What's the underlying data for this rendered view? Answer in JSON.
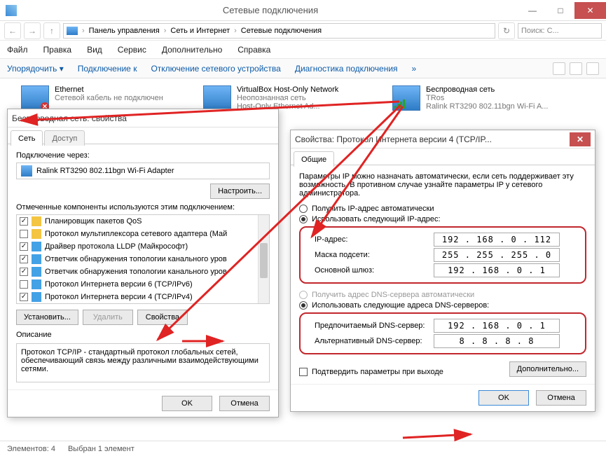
{
  "window": {
    "title": "Сетевые подключения",
    "minimize": "—",
    "maximize": "□",
    "close": "✕"
  },
  "nav": {
    "back": "←",
    "fwd": "→",
    "up": "↑",
    "crumbs": [
      "Панель управления",
      "Сеть и Интернет",
      "Сетевые подключения"
    ],
    "sep": "›",
    "refresh": "↻",
    "search_placeholder": "Поиск: С..."
  },
  "menu": [
    "Файл",
    "Правка",
    "Вид",
    "Сервис",
    "Дополнительно",
    "Справка"
  ],
  "commands": {
    "organize": "Упорядочить ▾",
    "connect": "Подключение к",
    "disable": "Отключение сетевого устройства",
    "diag": "Диагностика подключения",
    "more": "»"
  },
  "items": {
    "eth": {
      "name": "Ethernet",
      "status": "Сетевой кабель не подключен"
    },
    "vbox": {
      "name": "VirtualBox Host-Only Network",
      "status": "Неопознанная сеть",
      "driver": "Host-Only Ethernet Ad..."
    },
    "wifi": {
      "name": "Беспроводная сеть",
      "status": "TRos",
      "driver": "Ralink RT3290 802.11bgn Wi-Fi A..."
    }
  },
  "status": {
    "count": "Элементов: 4",
    "sel": "Выбран 1 элемент"
  },
  "dlg1": {
    "title": "Беспроводная сеть: свойства",
    "tabs": [
      "Сеть",
      "Доступ"
    ],
    "conn_via": "Подключение через:",
    "adapter": "Ralink RT3290 802.11bgn Wi-Fi Adapter",
    "configure": "Настроить...",
    "components_label": "Отмеченные компоненты используются этим подключением:",
    "components": [
      {
        "checked": true,
        "label": "Планировщик пакетов QoS"
      },
      {
        "checked": false,
        "label": "Протокол мультиплексора сетевого адаптера (Май"
      },
      {
        "checked": true,
        "label": "Драйвер протокола LLDP (Майкрософт)"
      },
      {
        "checked": true,
        "label": "Ответчик обнаружения топологии канального уров"
      },
      {
        "checked": true,
        "label": "Ответчик обнаружения топологии канального уров"
      },
      {
        "checked": false,
        "label": "Протокол Интернета версии 6 (TCP/IPv6)"
      },
      {
        "checked": true,
        "label": "Протокол Интернета версии 4 (TCP/IPv4)"
      }
    ],
    "component_icons": [
      "#f4c542",
      "#f4c542",
      "#43a1e6",
      "#43a1e6",
      "#43a1e6",
      "#43a1e6",
      "#43a1e6"
    ],
    "install": "Установить...",
    "remove": "Удалить",
    "properties": "Свойства",
    "desc_title": "Описание",
    "desc_text": "Протокол TCP/IP - стандартный протокол глобальных сетей, обеспечивающий связь между различными взаимодействующими сетями.",
    "ok": "OK",
    "cancel": "Отмена"
  },
  "dlg2": {
    "title": "Свойства: Протокол Интернета версии 4 (TCP/IP...",
    "tab": "Общие",
    "intro": "Параметры IP можно назначать автоматически, если сеть поддерживает эту возможность. В противном случае узнайте параметры IP у сетевого администратора.",
    "ip_auto": "Получить IP-адрес автоматически",
    "ip_manual": "Использовать следующий IP-адрес:",
    "ip_rows": {
      "addr_lbl": "IP-адрес:",
      "addr_val": "192 . 168 .  0  . 112",
      "mask_lbl": "Маска подсети:",
      "mask_val": "255 . 255 . 255 .  0",
      "gw_lbl": "Основной шлюз:",
      "gw_val": "192 . 168 .  0  .  1"
    },
    "dns_auto": "Получить адрес DNS-сервера автоматически",
    "dns_manual": "Использовать следующие адреса DNS-серверов:",
    "dns_rows": {
      "pref_lbl": "Предпочитаемый DNS-сервер:",
      "pref_val": "192 . 168 .  0  .  1",
      "alt_lbl": "Альтернативный DNS-сервер:",
      "alt_val": "  8  .  8  .  8  .  8"
    },
    "validate": "Подтвердить параметры при выходе",
    "advanced": "Дополнительно...",
    "ok": "OK",
    "cancel": "Отмена"
  }
}
